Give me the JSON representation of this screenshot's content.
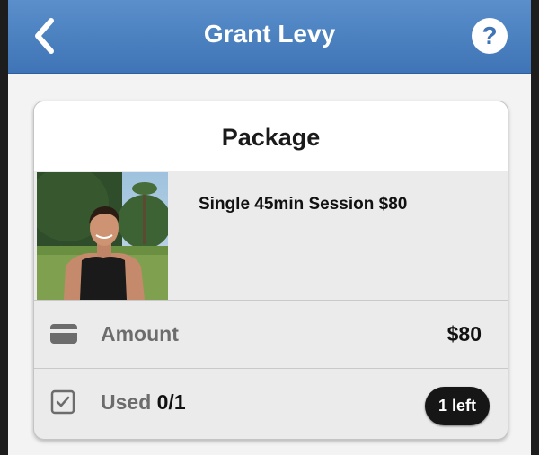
{
  "header": {
    "title": "Grant Levy",
    "back_icon": "chevron-left-icon",
    "help_label": "?",
    "background": "#4a80c0"
  },
  "card": {
    "title": "Package",
    "package": {
      "name": "Single 45min Session $80",
      "image": "trainer-photo"
    },
    "amount": {
      "label": "Amount",
      "value": "$80",
      "icon": "credit-card-icon"
    },
    "used": {
      "label": "Used",
      "count": "0/1",
      "icon": "checkbox-icon",
      "badge": "1 left"
    }
  }
}
